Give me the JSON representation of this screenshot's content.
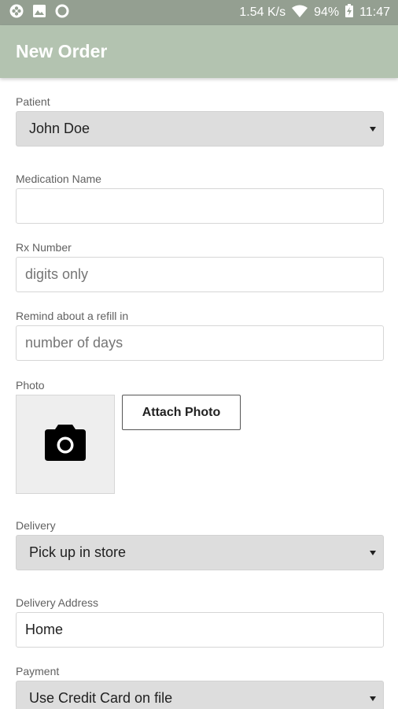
{
  "status_bar": {
    "left_icons": [
      "pinwheel-icon",
      "image-icon",
      "circle-icon"
    ],
    "network_speed": "1.54 K/s",
    "battery": "94%",
    "time": "11:47"
  },
  "app_bar": {
    "title": "New Order"
  },
  "form": {
    "patient": {
      "label": "Patient",
      "value": "John Doe"
    },
    "medication_name": {
      "label": "Medication Name",
      "value": ""
    },
    "rx_number": {
      "label": "Rx Number",
      "placeholder": "digits only"
    },
    "refill_reminder": {
      "label": "Remind about a refill in",
      "placeholder": "number of days"
    },
    "photo": {
      "label": "Photo",
      "attach_label": "Attach Photo"
    },
    "delivery": {
      "label": "Delivery",
      "value": "Pick up in store"
    },
    "delivery_address": {
      "label": "Delivery Address",
      "value": "Home"
    },
    "payment": {
      "label": "Payment",
      "value": "Use Credit Card on file"
    }
  },
  "colors": {
    "status_bar": "#949f91",
    "app_bar": "#b3c3b0",
    "select_background": "#dddddd"
  }
}
